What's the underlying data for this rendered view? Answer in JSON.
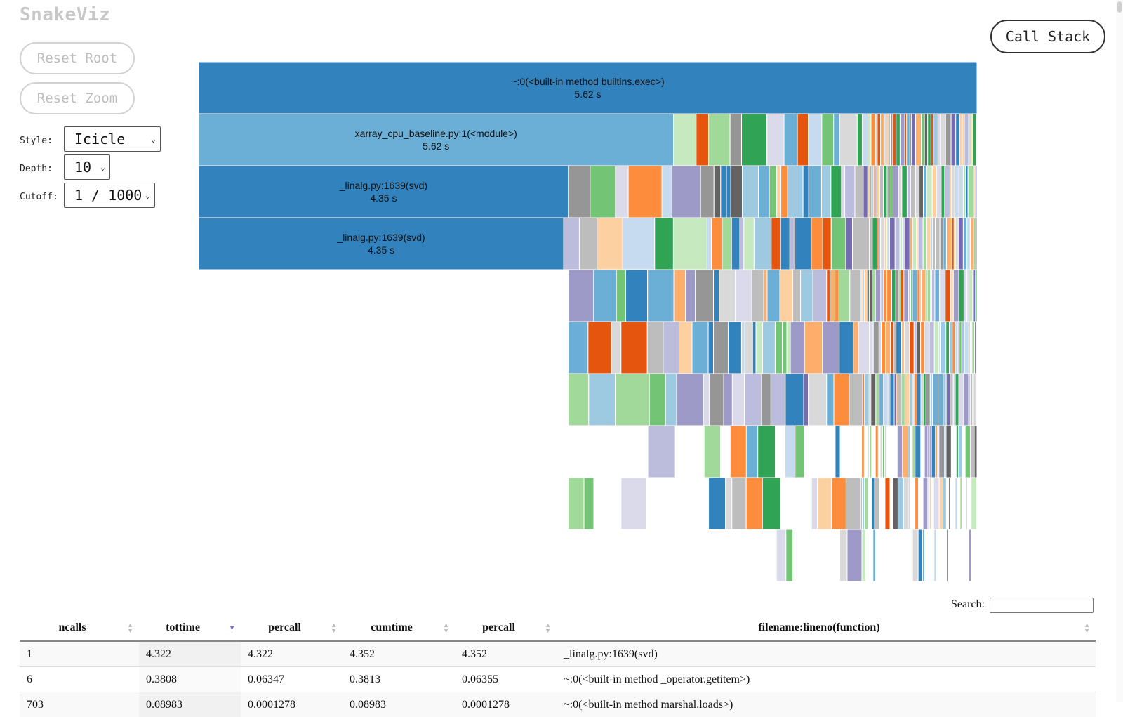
{
  "app": {
    "title": "SnakeViz"
  },
  "controls": {
    "reset_root": "Reset Root",
    "reset_zoom": "Reset Zoom",
    "call_stack": "Call Stack",
    "style_label": "Style:",
    "style_value": "Icicle",
    "depth_label": "Depth:",
    "depth_value": "10",
    "cutoff_label": "Cutoff:",
    "cutoff_value": "1 / 1000"
  },
  "icicle": {
    "labeled_blocks": [
      {
        "name": "~:0(<built-in method builtins.exec>)",
        "time": "5.62 s",
        "depth": 0,
        "share": 1.0,
        "color": "#3182bd"
      },
      {
        "name": "xarray_cpu_baseline.py:1(<module>)",
        "time": "5.62 s",
        "depth": 1,
        "share": 0.61,
        "color": "#6baed6"
      },
      {
        "name": "_linalg.py:1639(svd)",
        "time": "4.35 s",
        "depth": 2,
        "share": 0.475,
        "color": "#3182bd"
      },
      {
        "name": "_linalg.py:1639(svd)",
        "time": "4.35 s",
        "depth": 3,
        "share": 0.469,
        "color": "#3182bd"
      }
    ],
    "palette": [
      "#3182bd",
      "#6baed6",
      "#9ecae1",
      "#c6dbef",
      "#e6550d",
      "#fd8d3c",
      "#fdae6b",
      "#fdd0a2",
      "#31a354",
      "#74c476",
      "#a1d99b",
      "#c7e9c0",
      "#756bb1",
      "#9e9ac8",
      "#bcbddc",
      "#dadaeb",
      "#636363",
      "#969696",
      "#bdbdbd",
      "#d9d9d9"
    ]
  },
  "search": {
    "label": "Search:"
  },
  "table": {
    "columns": [
      "ncalls",
      "tottime",
      "percall",
      "cumtime",
      "percall",
      "filename:lineno(function)"
    ],
    "rows": [
      {
        "ncalls": "1",
        "tottime": "4.322",
        "percall": "4.322",
        "cumtime": "4.352",
        "percall2": "4.352",
        "func": "_linalg.py:1639(svd)"
      },
      {
        "ncalls": "6",
        "tottime": "0.3808",
        "percall": "0.06347",
        "cumtime": "0.3813",
        "percall2": "0.06355",
        "func": "~:0(<built-in method _operator.getitem>)"
      },
      {
        "ncalls": "703",
        "tottime": "0.08983",
        "percall": "0.0001278",
        "cumtime": "0.08983",
        "percall2": "0.0001278",
        "func": "~:0(<built-in method marshal.loads>)"
      }
    ]
  }
}
